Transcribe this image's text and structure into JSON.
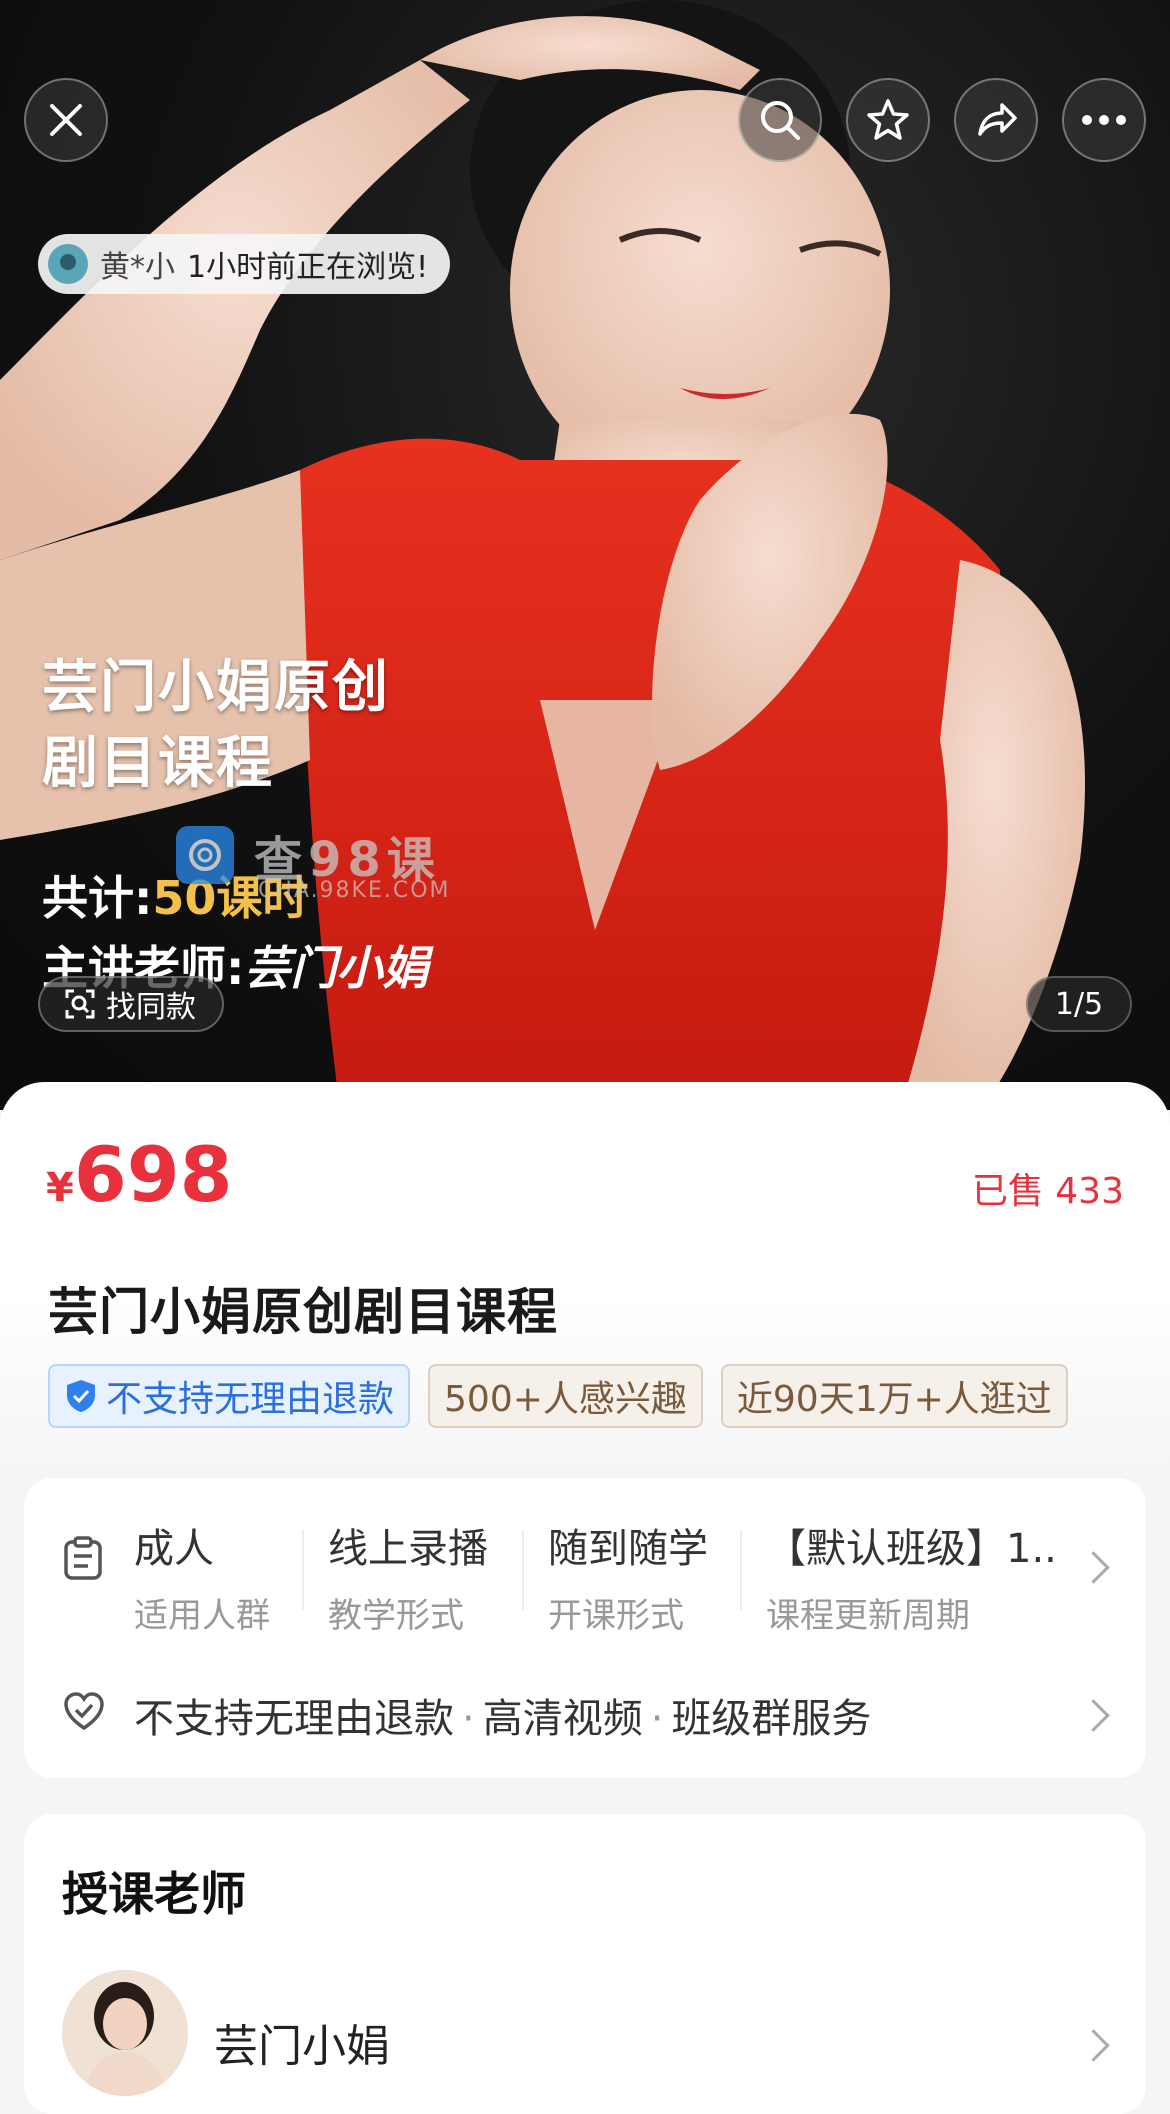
{
  "hero": {
    "browsing": {
      "user": "黄*小",
      "message": "1小时前正在浏览!"
    },
    "poster": {
      "title_line1": "芸门小娟原创",
      "title_line2": "剧目课程",
      "count_label": "共计:",
      "count_value": "50课时",
      "teacher_label": "主讲老师:",
      "teacher_value": "芸门小娟"
    },
    "watermark": {
      "text": "查98课",
      "sub": "CHA.98KE.COM"
    },
    "find_similar": "找同款",
    "page_indicator": "1/5"
  },
  "product": {
    "currency": "¥",
    "price": "698",
    "sold": "已售 433",
    "title": "芸门小娟原创剧目课程",
    "tags": [
      "不支持无理由退款",
      "500+人感兴趣",
      "近90天1万+人逛过"
    ]
  },
  "attributes": [
    {
      "value": "成人",
      "key": "适用人群"
    },
    {
      "value": "线上录播",
      "key": "教学形式"
    },
    {
      "value": "随到随学",
      "key": "开课形式"
    },
    {
      "value": "【默认班级】1..",
      "key": "课程更新周期"
    }
  ],
  "services": [
    "不支持无理由退款",
    "高清视频",
    "班级群服务"
  ],
  "teacher_section": {
    "title": "授课老师",
    "name": "芸门小娟"
  },
  "colors": {
    "accent_red": "#e8313d",
    "tag_blue": "#2a6fdb",
    "highlight_gold": "#f3c14b"
  },
  "icons": [
    "close-icon",
    "search-icon",
    "star-icon",
    "share-icon",
    "more-icon",
    "scan-icon",
    "shield-icon",
    "clipboard-icon",
    "heart-shield-icon",
    "chevron-right-icon"
  ]
}
